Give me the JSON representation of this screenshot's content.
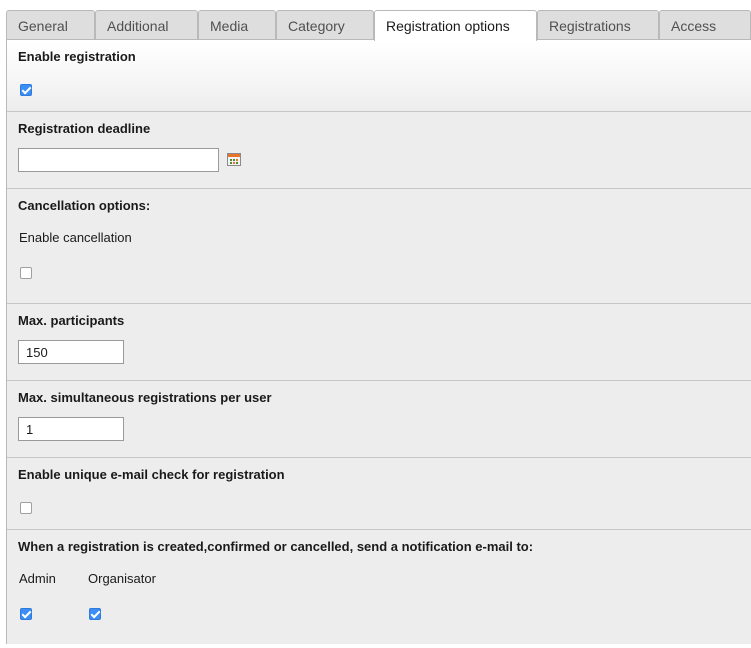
{
  "tabs": [
    {
      "label": "General"
    },
    {
      "label": "Additional"
    },
    {
      "label": "Media"
    },
    {
      "label": "Category"
    },
    {
      "label": "Registration options"
    },
    {
      "label": "Registrations"
    },
    {
      "label": "Access"
    }
  ],
  "active_tab": "Registration options",
  "form": {
    "enable_registration": {
      "label": "Enable registration",
      "checked": true
    },
    "registration_deadline": {
      "label": "Registration deadline",
      "value": "",
      "icon": "calendar-icon"
    },
    "cancellation": {
      "label": "Cancellation options:",
      "enable_label": "Enable cancellation",
      "checked": false
    },
    "max_participants": {
      "label": "Max. participants",
      "value": "150"
    },
    "max_simultaneous": {
      "label": "Max. simultaneous registrations per user",
      "value": "1"
    },
    "unique_email": {
      "label": "Enable unique e-mail check for registration",
      "checked": false
    },
    "notification": {
      "label": "When a registration is created,confirmed or cancelled, send a notification e-mail to:",
      "admin_label": "Admin",
      "admin_checked": true,
      "organisator_label": "Organisator",
      "organisator_checked": true
    }
  },
  "colors": {
    "checkbox_checked": "#3a8ef6",
    "panel_background": "#ededed",
    "tab_inactive": "#dedede"
  }
}
